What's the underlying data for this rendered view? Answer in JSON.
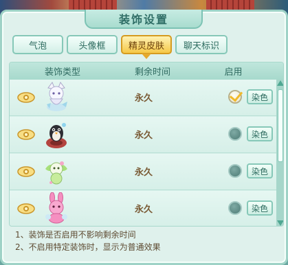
{
  "dialog": {
    "title": "装饰设置"
  },
  "tabs": [
    {
      "label": "气泡",
      "active": false
    },
    {
      "label": "头像框",
      "active": false
    },
    {
      "label": "精灵皮肤",
      "active": true
    },
    {
      "label": "聊天标识",
      "active": false
    }
  ],
  "table": {
    "headers": {
      "type": "装饰类型",
      "remaining": "剩余时间",
      "enable": "启用"
    },
    "rows": [
      {
        "remaining": "永久",
        "enabled": true,
        "dye_label": "染色",
        "sprite": "white-fox-spirit-icon"
      },
      {
        "remaining": "永久",
        "enabled": false,
        "dye_label": "染色",
        "sprite": "penguin-spirit-icon"
      },
      {
        "remaining": "永久",
        "enabled": false,
        "dye_label": "染色",
        "sprite": "green-fairy-spirit-icon"
      },
      {
        "remaining": "永久",
        "enabled": false,
        "dye_label": "染色",
        "sprite": "pink-rabbit-spirit-icon"
      }
    ]
  },
  "notes": [
    "1、装饰是否启用不影响剩余时间",
    "2、不启用特定装饰时，显示为普通效果"
  ]
}
